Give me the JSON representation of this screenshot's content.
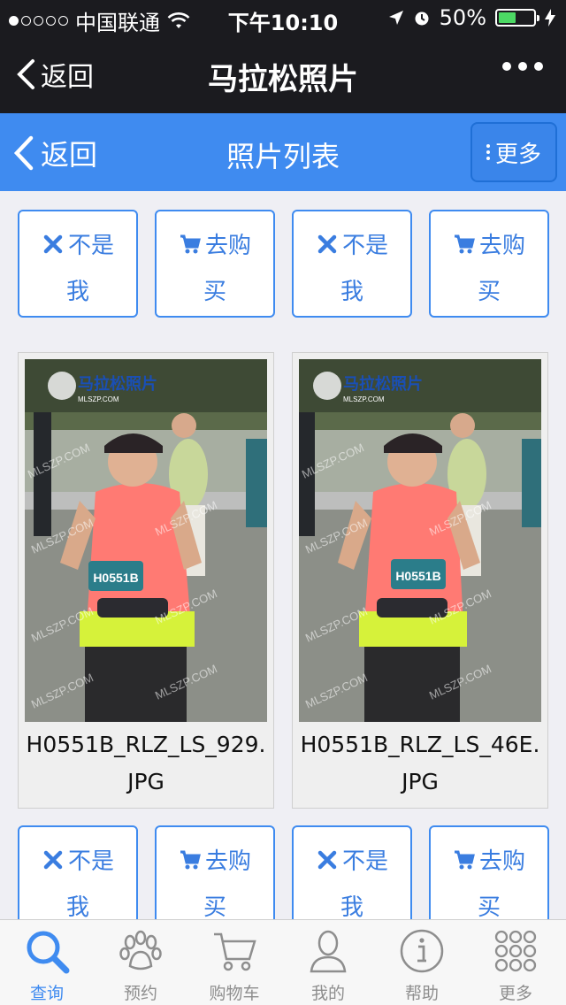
{
  "status_bar": {
    "carrier": "中国联通",
    "time": "下午10:10",
    "battery": "50%",
    "battery_level": 0.5
  },
  "wechat_bar": {
    "back_label": "返回",
    "title": "马拉松照片"
  },
  "header": {
    "back_label": "返回",
    "title": "照片列表",
    "more_label": "更多"
  },
  "actions": {
    "not_me_line1": "不是",
    "not_me_line2": "我",
    "buy_line1": "去购",
    "buy_line2": "买"
  },
  "photos": [
    {
      "filename": "H0551B_RLZ_LS_929.JPG",
      "logo": "马拉松照片",
      "logo_sub": "MLSZP.COM",
      "bib": "H0551B",
      "watermark": "MLSZP.COM"
    },
    {
      "filename": "H0551B_RLZ_LS_46E.JPG",
      "logo": "马拉松照片",
      "logo_sub": "MLSZP.COM",
      "bib": "H0551B",
      "watermark": "MLSZP.COM"
    }
  ],
  "tabs": [
    {
      "label": "查询",
      "icon": "search-icon",
      "active": true
    },
    {
      "label": "预约",
      "icon": "paw-icon",
      "active": false
    },
    {
      "label": "购物车",
      "icon": "cart-icon",
      "active": false
    },
    {
      "label": "我的",
      "icon": "user-icon",
      "active": false
    },
    {
      "label": "帮助",
      "icon": "info-icon",
      "active": false
    },
    {
      "label": "更多",
      "icon": "grid-icon",
      "active": false
    }
  ],
  "colors": {
    "accent": "#3f8bf0",
    "dark_bar": "#1b1b1f",
    "shirt": "#ff7a73",
    "skirt": "#d6f23a"
  }
}
